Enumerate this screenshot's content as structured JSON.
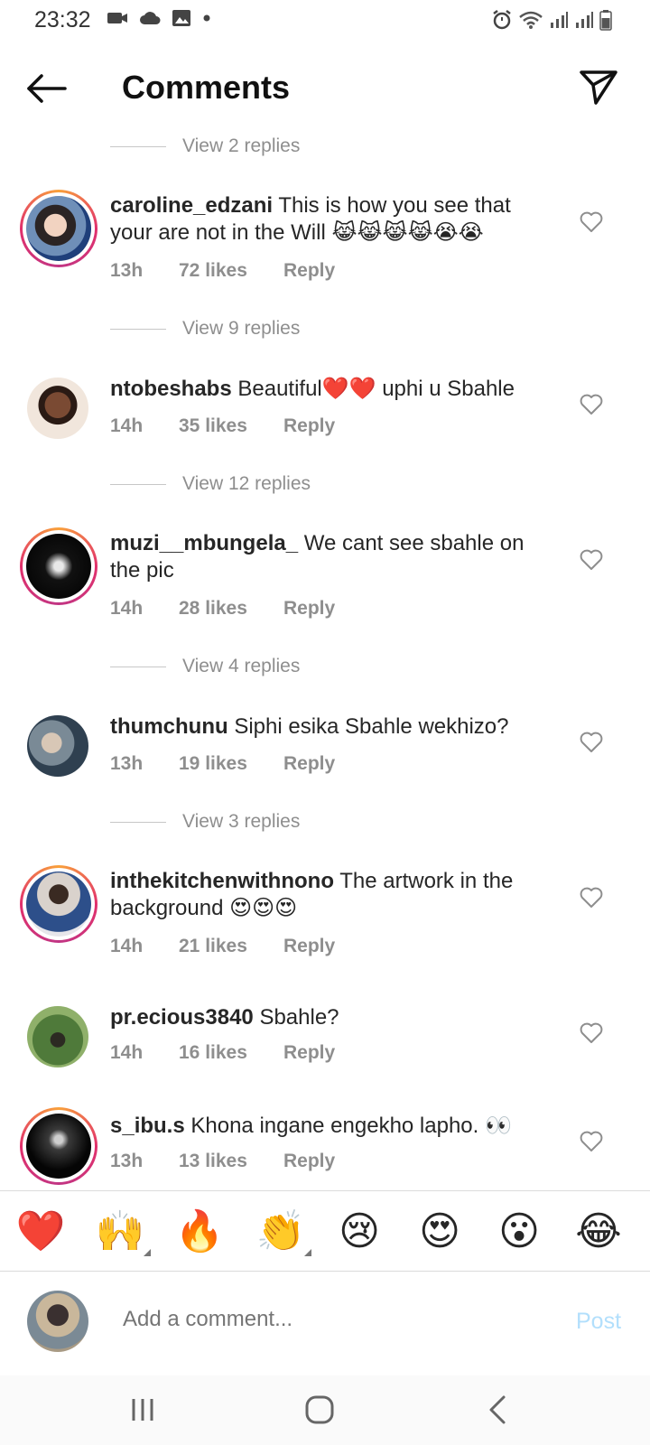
{
  "status": {
    "time": "23:32"
  },
  "header": {
    "title": "Comments"
  },
  "reply_links": [
    "View 2 replies",
    "View 9 replies",
    "View 12 replies",
    "View 4 replies",
    "View 3 replies"
  ],
  "comments": [
    {
      "user": "caroline_edzani",
      "text": "This is how you see that your are not in the Will 😹😹😹😹😭😭",
      "time": "13h",
      "likes": "72 likes",
      "reply": "Reply",
      "ring": true
    },
    {
      "user": "ntobeshabs",
      "text": "Beautiful❤️❤️ uphi u Sbahle",
      "time": "14h",
      "likes": "35 likes",
      "reply": "Reply",
      "ring": false
    },
    {
      "user": "muzi__mbungela_",
      "text": "We cant see sbahle on the pic",
      "time": "14h",
      "likes": "28 likes",
      "reply": "Reply",
      "ring": true
    },
    {
      "user": "thumchunu",
      "text": "Siphi esika Sbahle wekhizo?",
      "time": "13h",
      "likes": "19 likes",
      "reply": "Reply",
      "ring": false
    },
    {
      "user": "inthekitchenwithnono",
      "text": "The artwork in the background 😍😍😍",
      "time": "14h",
      "likes": "21 likes",
      "reply": "Reply",
      "ring": true
    },
    {
      "user": "pr.ecious3840",
      "text": "Sbahle?",
      "time": "14h",
      "likes": "16 likes",
      "reply": "Reply",
      "ring": false
    },
    {
      "user": "s_ibu.s",
      "text": "Khona ingane engekho lapho. 👀",
      "time": "13h",
      "likes": "13 likes",
      "reply": "Reply",
      "ring": true
    }
  ],
  "emoji_bar": [
    "❤️",
    "🙌",
    "🔥",
    "👏",
    "😢",
    "😍",
    "😮",
    "😂"
  ],
  "composer": {
    "placeholder": "Add a comment...",
    "post_label": "Post"
  },
  "colors": {
    "accent": "#0095f6",
    "post_disabled": "#b2dffc",
    "muted": "#8e8e8e",
    "ring_start": "#f9a13a",
    "ring_end": "#c13584"
  }
}
